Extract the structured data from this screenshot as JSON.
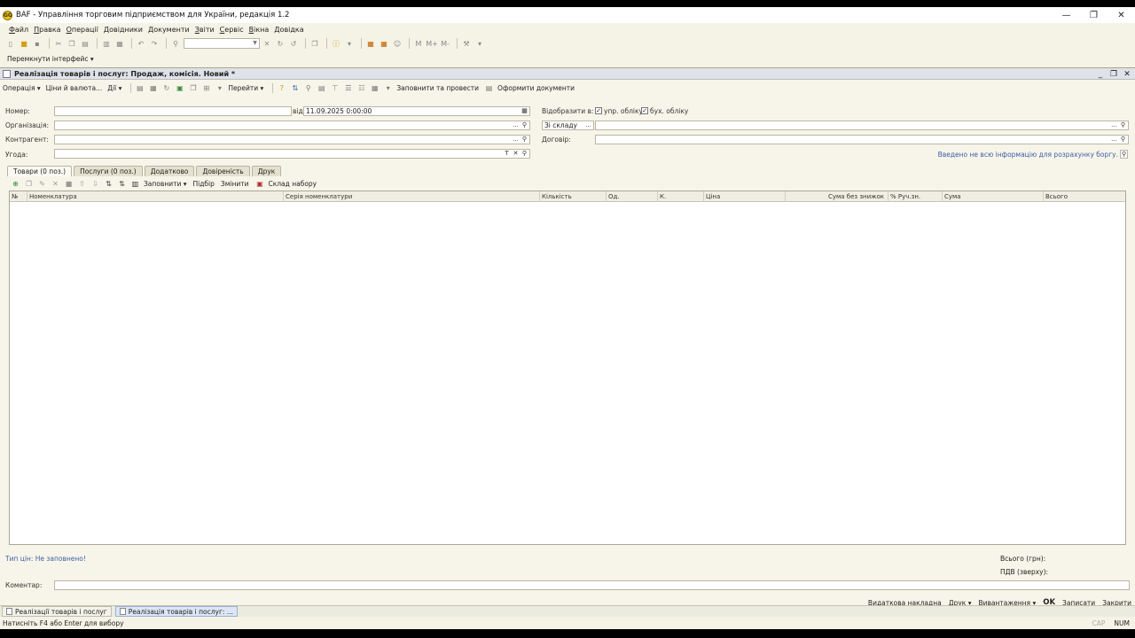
{
  "window": {
    "title": "BAF - Управління торговим підприємством для України, редакція 1.2",
    "app_icon_text": "GG"
  },
  "menu": [
    "Файл",
    "Правка",
    "Операції",
    "Довідники",
    "Документи",
    "Звіти",
    "Сервіс",
    "Вікна",
    "Довідка"
  ],
  "switch_interface": "Перемкнути інтерфейс",
  "document": {
    "title": "Реалізація товарів і послуг: Продаж, комісія. Новий *",
    "toolbar": {
      "operation": "Операція",
      "prices": "Ціни й валюта...",
      "actions": "Дії",
      "goto": "Перейти",
      "post_fill": "Заповнити та провести",
      "make_docs": "Оформити документи"
    },
    "fields": {
      "number_label": "Номер:",
      "number_value": "",
      "date_label": "від",
      "date_value": "11.09.2025  0:00:00",
      "org_label": "Організація:",
      "org_value": "",
      "contractor_label": "Контрагент:",
      "contractor_value": "",
      "deal_label": "Угода:",
      "deal_value": "",
      "show_in_label": "Відобразити в:",
      "mgmt_check": "упр. обліку",
      "acct_check": "бух. обліку",
      "warehouse_value": "Зі складу",
      "contract_label": "Договір:",
      "contract_value": "",
      "debt_link": "Введено не всю інформацію для розрахунку боргу."
    },
    "tabs": [
      "Товари (0 поз.)",
      "Послуги (0 поз.)",
      "Додатково",
      "Довіреність",
      "Друк"
    ],
    "tab_toolbar": {
      "fill": "Заповнити",
      "pick": "Підбір",
      "change": "Змінити",
      "set_warehouse": "Склад набору"
    },
    "table_columns": [
      "№",
      "Номенклатура",
      "Серія номенклатури",
      "Кількість",
      "Од.",
      "К.",
      "Ціна",
      "Сума без знижок",
      "% Руч.зн.",
      "Сума",
      "Всього"
    ],
    "footer": {
      "price_type_link": "Тип цін: Не заповнено!",
      "total_label": "Всього (грн):",
      "vat_label": "ПДВ (зверху):",
      "comment_label": "Коментар:",
      "comment_value": ""
    },
    "bottom_buttons": {
      "invoice": "Видаткова накладна",
      "print": "Друк",
      "export": "Вивантаження",
      "ok": "OK",
      "save": "Записати",
      "close": "Закрити"
    }
  },
  "taskbar": [
    "Реалізації товарів і послуг",
    "Реалізація товарів і послуг: ..."
  ],
  "status": {
    "hint": "Натисніть F4 або Enter для вибору",
    "cap": "CAP",
    "num": "NUM"
  }
}
